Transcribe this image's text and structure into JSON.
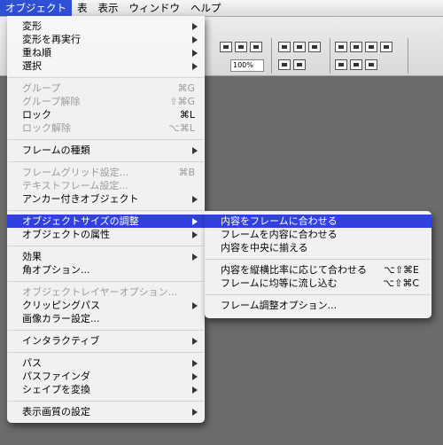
{
  "menubar": {
    "items": [
      {
        "label": "オブジェクト",
        "active": true
      },
      {
        "label": "表"
      },
      {
        "label": "表示"
      },
      {
        "label": "ウィンドウ"
      },
      {
        "label": "ヘルプ"
      }
    ]
  },
  "toolbar": {
    "zoom_value": "100%"
  },
  "object_menu": {
    "items": [
      {
        "label": "変形",
        "submenu": true
      },
      {
        "label": "変形を再実行",
        "submenu": true
      },
      {
        "label": "重ね順",
        "submenu": true
      },
      {
        "label": "選択",
        "submenu": true
      },
      {
        "label": "グループ",
        "shortcut": "⌘G",
        "disabled": true
      },
      {
        "label": "グループ解除",
        "shortcut": "⇧⌘G",
        "disabled": true
      },
      {
        "label": "ロック",
        "shortcut": "⌘L"
      },
      {
        "label": "ロック解除",
        "shortcut": "⌥⌘L",
        "disabled": true
      },
      {
        "label": "フレームの種類",
        "submenu": true
      },
      {
        "label": "フレームグリッド設定...",
        "shortcut": "⌘B",
        "disabled": true
      },
      {
        "label": "テキストフレーム設定...",
        "disabled": true
      },
      {
        "label": "アンカー付きオブジェクト",
        "submenu": true
      },
      {
        "label": "オブジェクトサイズの調整",
        "submenu": true,
        "highlighted": true
      },
      {
        "label": "オブジェクトの属性",
        "submenu": true
      },
      {
        "label": "効果",
        "submenu": true
      },
      {
        "label": "角オプション..."
      },
      {
        "label": "オブジェクトレイヤーオプション...",
        "disabled": true
      },
      {
        "label": "クリッピングパス",
        "submenu": true
      },
      {
        "label": "画像カラー設定..."
      },
      {
        "label": "インタラクティブ",
        "submenu": true
      },
      {
        "label": "パス",
        "submenu": true
      },
      {
        "label": "パスファインダ",
        "submenu": true
      },
      {
        "label": "シェイプを変換",
        "submenu": true
      },
      {
        "label": "表示画質の設定",
        "submenu": true
      }
    ]
  },
  "fitting_submenu": {
    "items": [
      {
        "label": "内容をフレームに合わせる",
        "highlighted": true
      },
      {
        "label": "フレームを内容に合わせる"
      },
      {
        "label": "内容を中央に揃える"
      },
      {
        "label": "内容を縦横比率に応じて合わせる",
        "shortcut": "⌥⇧⌘E"
      },
      {
        "label": "フレームに均等に流し込む",
        "shortcut": "⌥⇧⌘C"
      },
      {
        "label": "フレーム調整オプション..."
      }
    ]
  },
  "colors": {
    "highlight": "#3140e0",
    "menubar_active": "#2f4fd4",
    "canvas": "#6b6b6b"
  }
}
